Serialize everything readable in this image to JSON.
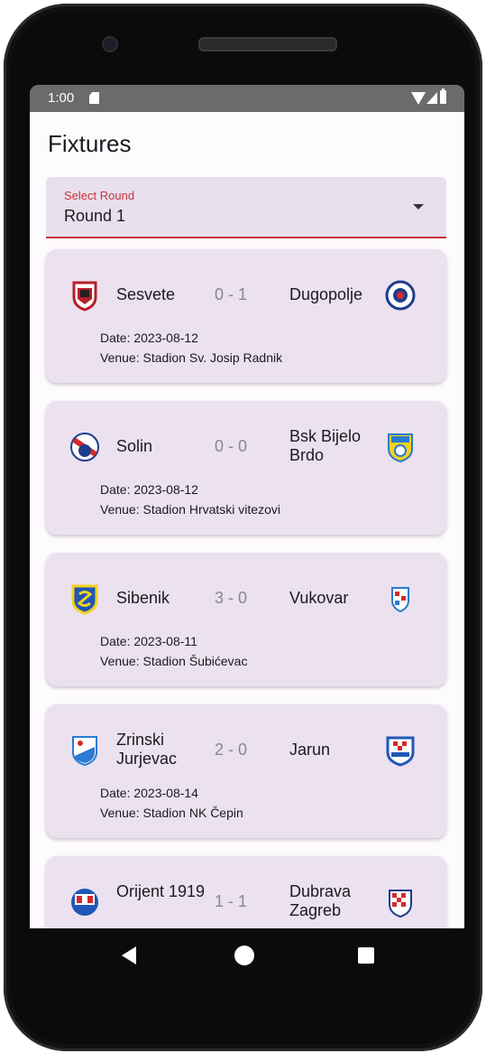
{
  "status": {
    "time": "1:00"
  },
  "page": {
    "title": "Fixtures"
  },
  "round_select": {
    "label": "Select Round",
    "value": "Round 1"
  },
  "colors": {
    "accent": "#c7333e",
    "card": "#ebe1ef",
    "field": "#e8e0ec"
  },
  "fixtures": [
    {
      "home": "Sesvete",
      "score": "0 - 1",
      "away": "Dugopolje",
      "date": "Date: 2023-08-12",
      "venue": "Venue: Stadion Sv. Josip Radnik"
    },
    {
      "home": "Solin",
      "score": "0 - 0",
      "away": "Bsk Bijelo Brdo",
      "date": "Date: 2023-08-12",
      "venue": "Venue: Stadion Hrvatski vitezovi"
    },
    {
      "home": "Sibenik",
      "score": "3 - 0",
      "away": "Vukovar",
      "date": "Date: 2023-08-11",
      "venue": "Venue: Stadion Šubićevac"
    },
    {
      "home": "Zrinski Jurjevac",
      "score": "2 - 0",
      "away": "Jarun",
      "date": "Date: 2023-08-14",
      "venue": "Venue: Stadion NK Čepin"
    },
    {
      "home": "Orijent 1919",
      "score": "1 - 1",
      "away": "Dubrava Zagreb",
      "date": "",
      "venue": ""
    }
  ]
}
